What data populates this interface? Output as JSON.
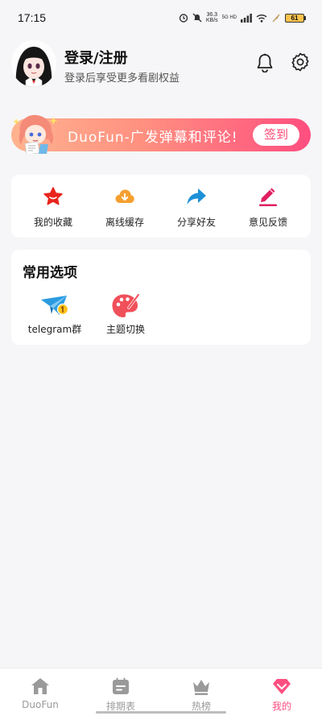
{
  "status_bar": {
    "time": "17:15",
    "speed_value": "36.3",
    "speed_unit": "KB/s",
    "network": "5G HD",
    "battery": "61"
  },
  "profile": {
    "title": "登录/注册",
    "subtitle": "登录后享受更多看剧权益"
  },
  "banner": {
    "text": "DuoFun-广发弹幕和评论!",
    "button_label": "签到"
  },
  "quick_actions": [
    {
      "label": "我的收藏",
      "icon": "star-icon"
    },
    {
      "label": "离线缓存",
      "icon": "cloud-download-icon"
    },
    {
      "label": "分享好友",
      "icon": "share-arrow-icon"
    },
    {
      "label": "意见反馈",
      "icon": "pencil-icon"
    }
  ],
  "options": {
    "title": "常用选项",
    "items": [
      {
        "label": "telegram群",
        "icon": "telegram-icon"
      },
      {
        "label": "主题切换",
        "icon": "palette-icon"
      }
    ]
  },
  "bottom_nav": {
    "active_index": 3,
    "items": [
      {
        "label": "DuoFun",
        "icon": "home-icon"
      },
      {
        "label": "排期表",
        "icon": "calendar-icon"
      },
      {
        "label": "热榜",
        "icon": "crown-icon"
      },
      {
        "label": "我的",
        "icon": "diamond-icon"
      }
    ]
  },
  "colors": {
    "accent": "#ff4f80",
    "star": "#e8241c",
    "cloud": "#f5a030",
    "share": "#1e90d8",
    "pencil": "#e02060",
    "nav_inactive": "#9a9a9a"
  }
}
